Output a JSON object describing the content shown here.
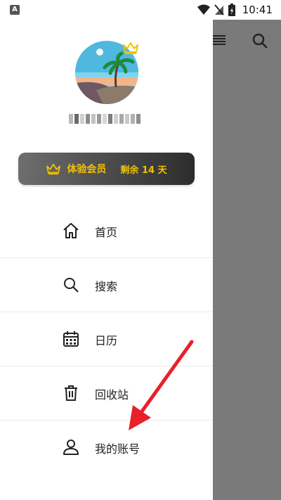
{
  "status_bar": {
    "time": "10:41",
    "app_badge": "A"
  },
  "user": {
    "name_masked": ""
  },
  "vip": {
    "label": "体验会员",
    "remaining": "剩余 14 天"
  },
  "menu": [
    {
      "label": "首页",
      "icon": "home-icon"
    },
    {
      "label": "搜索",
      "icon": "search-icon"
    },
    {
      "label": "日历",
      "icon": "calendar-icon"
    },
    {
      "label": "回收站",
      "icon": "trash-icon"
    },
    {
      "label": "我的账号",
      "icon": "account-icon"
    }
  ],
  "colors": {
    "vip_gold": "#f2c200",
    "annotation_arrow": "#e8202a",
    "overlay": "#7a7a7a"
  }
}
